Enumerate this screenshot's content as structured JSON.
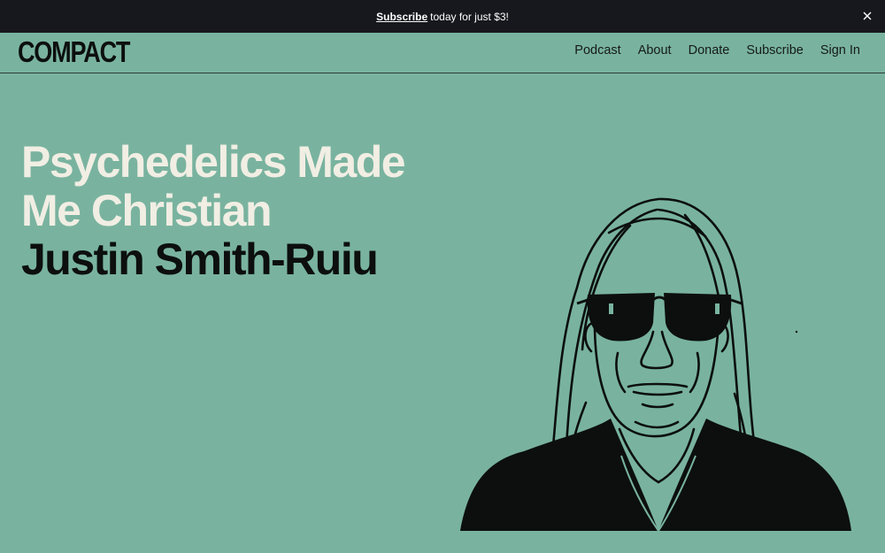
{
  "promo": {
    "link_label": "Subscribe",
    "text": "today for just $3!"
  },
  "header": {
    "logo": "COMPACT",
    "nav": [
      {
        "label": "Podcast"
      },
      {
        "label": "About"
      },
      {
        "label": "Donate"
      },
      {
        "label": "Subscribe"
      },
      {
        "label": "Sign In"
      }
    ]
  },
  "article": {
    "title_line1": "Psychedelics Made",
    "title_line2": "Me Christian",
    "author": "Justin Smith-Ruiu"
  },
  "colors": {
    "background": "#79b39f",
    "promo_bar": "#17181d",
    "title": "#f1eee4",
    "ink": "#0c0f0e"
  },
  "icons": {
    "close": "close-icon"
  }
}
